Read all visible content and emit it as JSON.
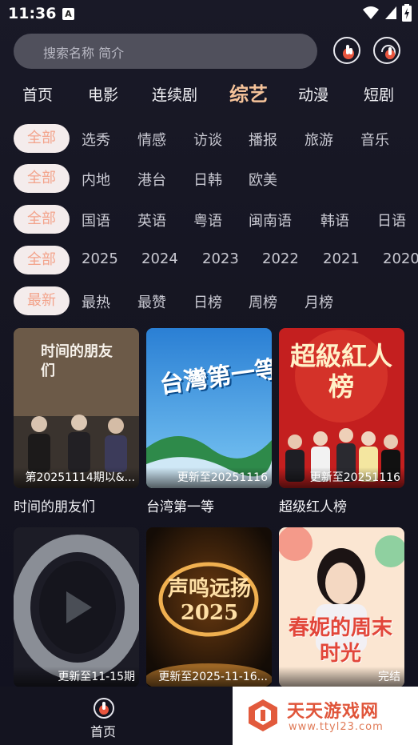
{
  "status_bar": {
    "time": "11:36",
    "app_badge": "A"
  },
  "search": {
    "placeholder": "搜索名称 简介"
  },
  "top_tabs": [
    {
      "label": "首页",
      "active": false
    },
    {
      "label": "电影",
      "active": false
    },
    {
      "label": "连续剧",
      "active": false
    },
    {
      "label": "综艺",
      "active": true
    },
    {
      "label": "动漫",
      "active": false
    },
    {
      "label": "短剧",
      "active": false
    }
  ],
  "filters": {
    "genre": {
      "selected": "全部",
      "options": [
        "选秀",
        "情感",
        "访谈",
        "播报",
        "旅游",
        "音乐"
      ]
    },
    "region": {
      "selected": "全部",
      "options": [
        "内地",
        "港台",
        "日韩",
        "欧美"
      ]
    },
    "language": {
      "selected": "全部",
      "options": [
        "国语",
        "英语",
        "粤语",
        "闽南语",
        "韩语",
        "日语"
      ]
    },
    "year": {
      "selected": "全部",
      "options": [
        "2025",
        "2024",
        "2023",
        "2022",
        "2021",
        "2020"
      ]
    },
    "sort": {
      "selected": "最新",
      "options": [
        "最热",
        "最赞",
        "日榜",
        "周榜",
        "月榜"
      ]
    }
  },
  "cards": [
    {
      "title": "时间的朋友们",
      "badge": "第20251114期以&...",
      "poster_text": "时间的朋友们",
      "accent": "#8a6a4e"
    },
    {
      "title": "台湾第一等",
      "badge": "更新至20251116",
      "poster_text": "台灣第一等",
      "accent": "#2e8fe0"
    },
    {
      "title": "超级红人榜",
      "badge": "更新至20251116",
      "poster_text": "超級紅人榜",
      "accent": "#d22a2a"
    },
    {
      "title": "",
      "badge": "更新至11-15期",
      "poster_text": "",
      "accent": "#555a62"
    },
    {
      "title": "",
      "badge": "更新至2025-11-16...",
      "poster_text": "声鸣远扬 2025",
      "accent": "#b8741e"
    },
    {
      "title": "",
      "badge": "完结",
      "poster_text": "春妮的周末时光",
      "accent": "#e44a3c"
    }
  ],
  "bottom_nav": {
    "home_label": "首页"
  },
  "watermark": {
    "title": "天天游戏网",
    "url": "www.ttyl23.com"
  },
  "colors": {
    "accent": "#f6c39a",
    "chip_text": "#f3a48c",
    "chip_bg": "#f4ecec",
    "background": "#141421"
  }
}
